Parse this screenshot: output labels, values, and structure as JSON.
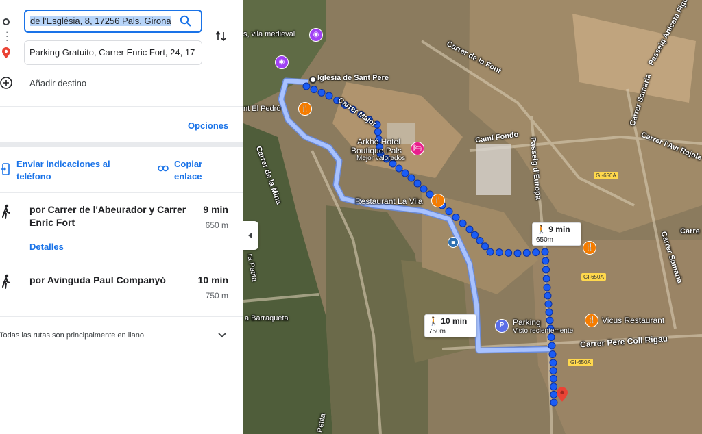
{
  "directions": {
    "origin_value": "de l'Església, 8, 17256 Pals, Girona",
    "destination_value": "Parking Gratuito, Carrer Enric Fort, 24, 17",
    "add_destination": "Añadir destino",
    "options": "Opciones",
    "send_to_phone": "Enviar indicaciones al teléfono",
    "copy_link": "Copiar enlace",
    "routes": [
      {
        "via": "por Carrer de l'Abeurador y Carrer Enric Fort",
        "time": "9 min",
        "distance": "650 m",
        "details": "Detalles"
      },
      {
        "via": "por Avinguda Paul Companyó",
        "time": "10 min",
        "distance": "750 m"
      }
    ],
    "terrain_note": "Todas las rutas son principalmente en llano"
  },
  "map": {
    "places": {
      "church": "Iglesia de Sant Pere",
      "village": "s, vila medieval",
      "restaurant_pedro": "nt El Pedró",
      "hotel_line1": "Arkhé Hotel",
      "hotel_line2": "Boutique Pals",
      "hotel_line3": "Mejor valorados",
      "restaurant_vila": "Restaurant La Vila",
      "parking": "Parking",
      "parking_sub": "Visto recientemente",
      "vicus": "Vicus Restaurant"
    },
    "streets": {
      "font": "Carrer de la Font",
      "major": "Carrer Major",
      "fondo": "Camí Fondo",
      "europa": "Passeig d'Europa",
      "mina": "Carrer de la Mina",
      "samaria1": "Carrer Samaria",
      "samaria2": "Carrer Samaria",
      "avi": "Carrer l'Avi Rajole",
      "aniceta": "Passeig Aniceta Figu",
      "coll": "Carrer Pere Coll Rigau",
      "barraqueta": "a Barraqueta",
      "petita1": "ra Petita",
      "petita2": "Petita",
      "carre": "Carre"
    },
    "roads": {
      "gi1": "GI-650A",
      "gi2": "GI-650A",
      "gi3": "GI-650A"
    },
    "callouts": {
      "route1_time": "9 min",
      "route1_dist": "650m",
      "route2_time": "10 min",
      "route2_dist": "750m"
    },
    "colors": {
      "selected_route": "#1a5cf5",
      "alternate_route": "#a8c2ff",
      "destination_pin": "#ea4335"
    }
  }
}
